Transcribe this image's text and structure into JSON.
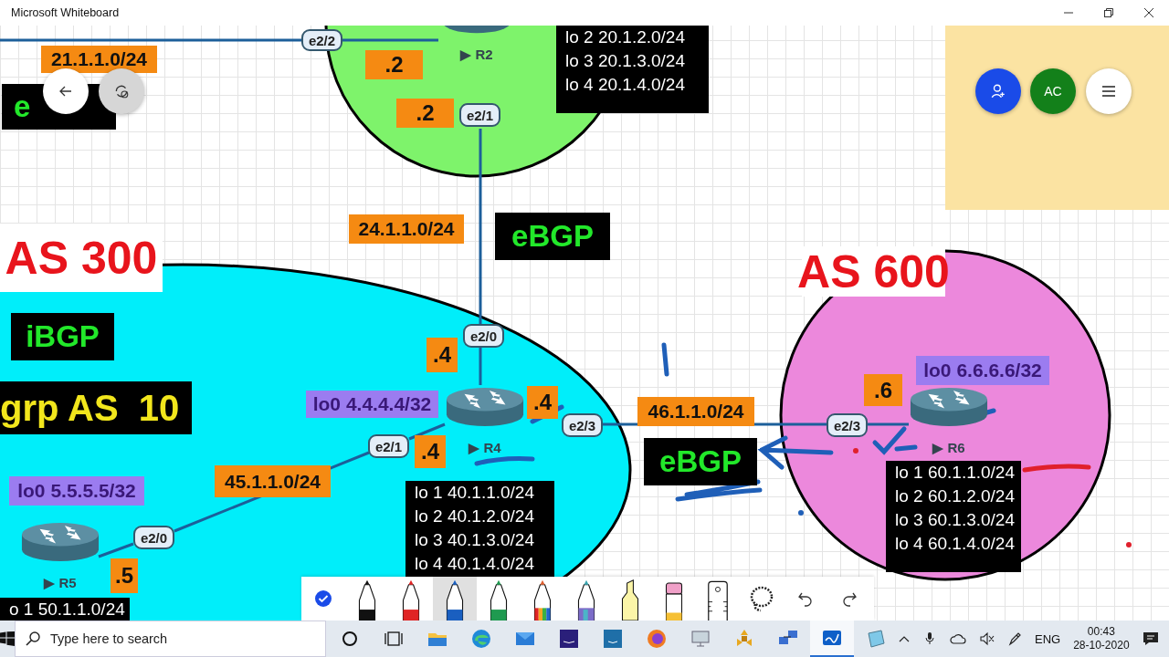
{
  "window": {
    "title": "Microsoft Whiteboard"
  },
  "canvas": {
    "items": [
      {
        "kind": "subnet",
        "text": "21.1.1.0/24"
      },
      {
        "kind": "bgp",
        "text": "e"
      },
      {
        "kind": "iface",
        "text": "e2/2"
      },
      {
        "kind": "host",
        "text": ".2"
      },
      {
        "kind": "host",
        "text": ".2"
      },
      {
        "kind": "router",
        "text": "▶ R2"
      },
      {
        "kind": "iface",
        "text": "e2/1"
      },
      {
        "kind": "list",
        "lines": [
          "lo 2 20.1.2.0/24",
          "lo 3 20.1.3.0/24",
          "lo 4 20.1.4.0/24"
        ]
      },
      {
        "kind": "subnet",
        "text": "24.1.1.0/24"
      },
      {
        "kind": "bgp",
        "text": "eBGP"
      },
      {
        "kind": "as",
        "text": "AS 300"
      },
      {
        "kind": "bgp",
        "text": "iBGP"
      },
      {
        "kind": "note",
        "text": "grp AS  10"
      },
      {
        "kind": "iface",
        "text": "e2/0"
      },
      {
        "kind": "host",
        "text": ".4"
      },
      {
        "kind": "loopback",
        "text": "lo0 4.4.4.4/32"
      },
      {
        "kind": "router",
        "text": "▶ R4"
      },
      {
        "kind": "host",
        "text": ".4"
      },
      {
        "kind": "iface",
        "text": "e2/3"
      },
      {
        "kind": "iface",
        "text": "e2/1"
      },
      {
        "kind": "host",
        "text": ".4"
      },
      {
        "kind": "subnet",
        "text": "45.1.1.0/24"
      },
      {
        "kind": "loopback",
        "text": "lo0 5.5.5.5/32"
      },
      {
        "kind": "router",
        "text": "▶ R5"
      },
      {
        "kind": "iface",
        "text": "e2/0"
      },
      {
        "kind": "host",
        "text": ".5"
      },
      {
        "kind": "list",
        "lines": [
          "o 1 50.1.1.0/24"
        ]
      },
      {
        "kind": "list",
        "lines": [
          "lo 1 40.1.1.0/24",
          "lo 2 40.1.2.0/24",
          "lo 3 40.1.3.0/24",
          "lo 4 40.1.4.0/24"
        ]
      },
      {
        "kind": "subnet",
        "text": "46.1.1.0/24"
      },
      {
        "kind": "bgp",
        "text": "eBGP"
      },
      {
        "kind": "as",
        "text": "AS 600"
      },
      {
        "kind": "loopback",
        "text": "lo0 6.6.6.6/32"
      },
      {
        "kind": "host",
        "text": ".6"
      },
      {
        "kind": "iface",
        "text": "e2/3"
      },
      {
        "kind": "router",
        "text": "▶ R6"
      },
      {
        "kind": "list",
        "lines": [
          "lo 1 60.1.1.0/24",
          "lo 2 60.1.2.0/24",
          "lo 3 60.1.3.0/24",
          "lo 4 60.1.4.0/24"
        ]
      }
    ],
    "avatar": {
      "initials": "AC"
    }
  },
  "toolbar": {
    "tools": [
      {
        "kind": "select",
        "selected": false
      },
      {
        "kind": "pen",
        "color": "#111111",
        "selected": false
      },
      {
        "kind": "pen",
        "color": "#e02424",
        "selected": false
      },
      {
        "kind": "pen",
        "color": "#1a5fc0",
        "selected": true
      },
      {
        "kind": "pen",
        "color": "#1f9a50",
        "selected": false
      },
      {
        "kind": "rainbow-pen",
        "selected": false
      },
      {
        "kind": "galaxy-pen",
        "selected": false
      },
      {
        "kind": "highlighter",
        "selected": false
      },
      {
        "kind": "eraser",
        "selected": false
      },
      {
        "kind": "ruler",
        "selected": false
      },
      {
        "kind": "lasso",
        "selected": false
      },
      {
        "kind": "undo"
      },
      {
        "kind": "redo"
      }
    ]
  },
  "taskbar": {
    "search": {
      "placeholder": "Type here to search"
    },
    "apps": [
      {
        "kind": "cortana",
        "selected": false
      },
      {
        "kind": "task-view",
        "selected": false
      },
      {
        "kind": "folder",
        "selected": false
      },
      {
        "kind": "edge",
        "selected": false
      },
      {
        "kind": "mail",
        "selected": false
      },
      {
        "kind": "music",
        "selected": false
      },
      {
        "kind": "video",
        "selected": false
      },
      {
        "kind": "firefox",
        "selected": false
      },
      {
        "kind": "monitor",
        "selected": false
      },
      {
        "kind": "network",
        "selected": false
      },
      {
        "kind": "computers",
        "selected": false
      },
      {
        "kind": "whiteboard",
        "selected": true
      },
      {
        "kind": "notepad",
        "selected": false
      }
    ],
    "language": "ENG",
    "time": "00:43",
    "date": "28-10-2020"
  }
}
